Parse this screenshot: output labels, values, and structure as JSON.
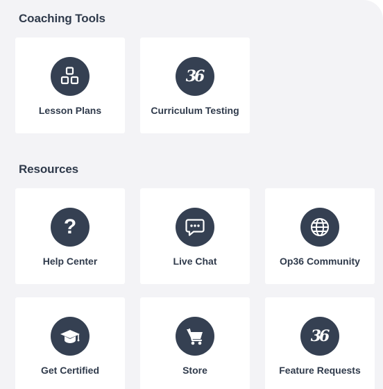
{
  "coaching_tools": {
    "title": "Coaching Tools",
    "tiles": [
      {
        "label": "Lesson Plans",
        "icon": "lesson-plans-icon"
      },
      {
        "label": "Curriculum Testing",
        "icon": "op36-logo-icon",
        "icon_text": "36"
      }
    ]
  },
  "resources": {
    "title": "Resources",
    "tiles": [
      {
        "label": "Help Center",
        "icon": "question-mark-icon",
        "icon_text": "?"
      },
      {
        "label": "Live Chat",
        "icon": "chat-bubble-icon"
      },
      {
        "label": "Op36 Community",
        "icon": "globe-icon"
      },
      {
        "label": "Get Certified",
        "icon": "graduation-cap-icon"
      },
      {
        "label": "Store",
        "icon": "shopping-cart-icon"
      },
      {
        "label": "Feature Requests",
        "icon": "op36-logo-icon",
        "icon_text": "36"
      }
    ]
  },
  "colors": {
    "background": "#f3f3f6",
    "tile": "#ffffff",
    "icon_circle": "#354052",
    "text": "#2f3a4b"
  }
}
